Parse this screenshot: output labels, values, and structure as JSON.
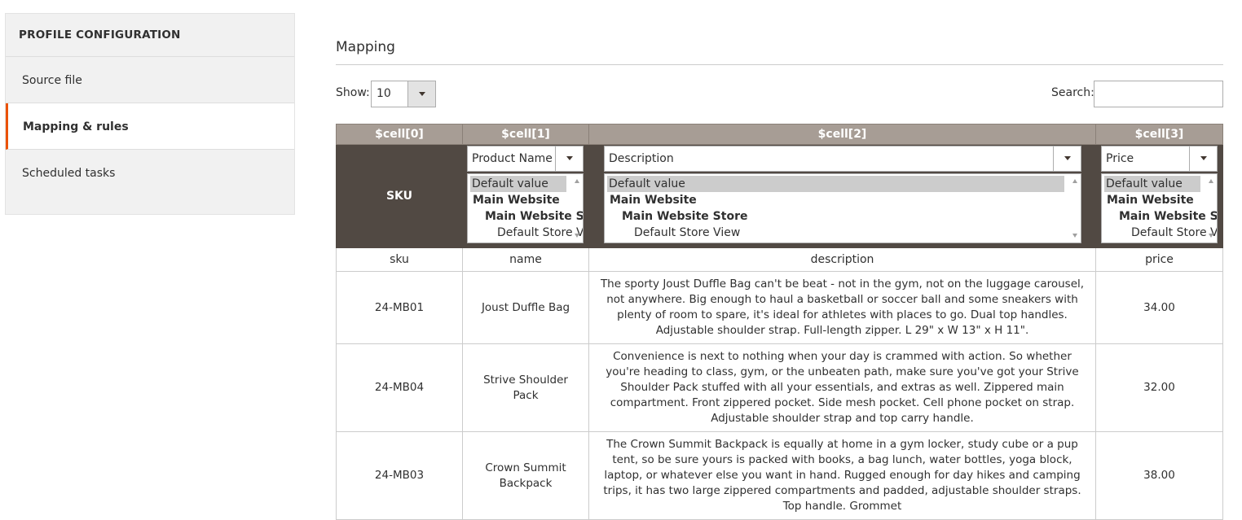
{
  "sidebar": {
    "title": "PROFILE CONFIGURATION",
    "items": [
      {
        "label": "Source file",
        "active": false
      },
      {
        "label": "Mapping & rules",
        "active": true
      },
      {
        "label": "Scheduled tasks",
        "active": false
      }
    ],
    "accent_color": "#eb5202"
  },
  "main": {
    "section_title": "Mapping",
    "show_label": "Show:",
    "show_value": "10",
    "search_label": "Search:",
    "search_value": ""
  },
  "table": {
    "cell_headers": [
      "$cell[0]",
      "$cell[1]",
      "$cell[2]",
      "$cell[3]"
    ],
    "mapping": {
      "sku_label": "SKU",
      "dropdowns": [
        "Product Name",
        "Description",
        "Price"
      ],
      "scope_options": [
        "Default value",
        "Main Website",
        "Main Website Store",
        "Default Store View"
      ]
    },
    "source_keys": [
      "sku",
      "name",
      "description",
      "price"
    ],
    "rows": [
      {
        "sku": "24-MB01",
        "name": "Joust Duffle Bag",
        "description": "The sporty Joust Duffle Bag can't be beat - not in the gym, not on the luggage carousel, not anywhere. Big enough to haul a basketball or soccer ball and some sneakers with plenty of room to spare, it's ideal for athletes with places to go. Dual top handles. Adjustable shoulder strap. Full-length zipper. L 29\" x W 13\" x H 11\".",
        "price": "34.00"
      },
      {
        "sku": "24-MB04",
        "name": "Strive Shoulder Pack",
        "description": "Convenience is next to nothing when your day is crammed with action. So whether you're heading to class, gym, or the unbeaten path, make sure you've got your Strive Shoulder Pack stuffed with all your essentials, and extras as well. Zippered main compartment. Front zippered pocket. Side mesh pocket. Cell phone pocket on strap. Adjustable shoulder strap and top carry handle.",
        "price": "32.00"
      },
      {
        "sku": "24-MB03",
        "name": "Crown Summit Backpack",
        "description": "The Crown Summit Backpack is equally at home in a gym locker, study cube or a pup tent, so be sure yours is packed with books, a bag lunch, water bottles, yoga block, laptop, or whatever else you want in hand. Rugged enough for day hikes and camping trips, it has two large zippered compartments and padded, adjustable shoulder straps. Top handle. Grommet",
        "price": "38.00"
      }
    ]
  }
}
